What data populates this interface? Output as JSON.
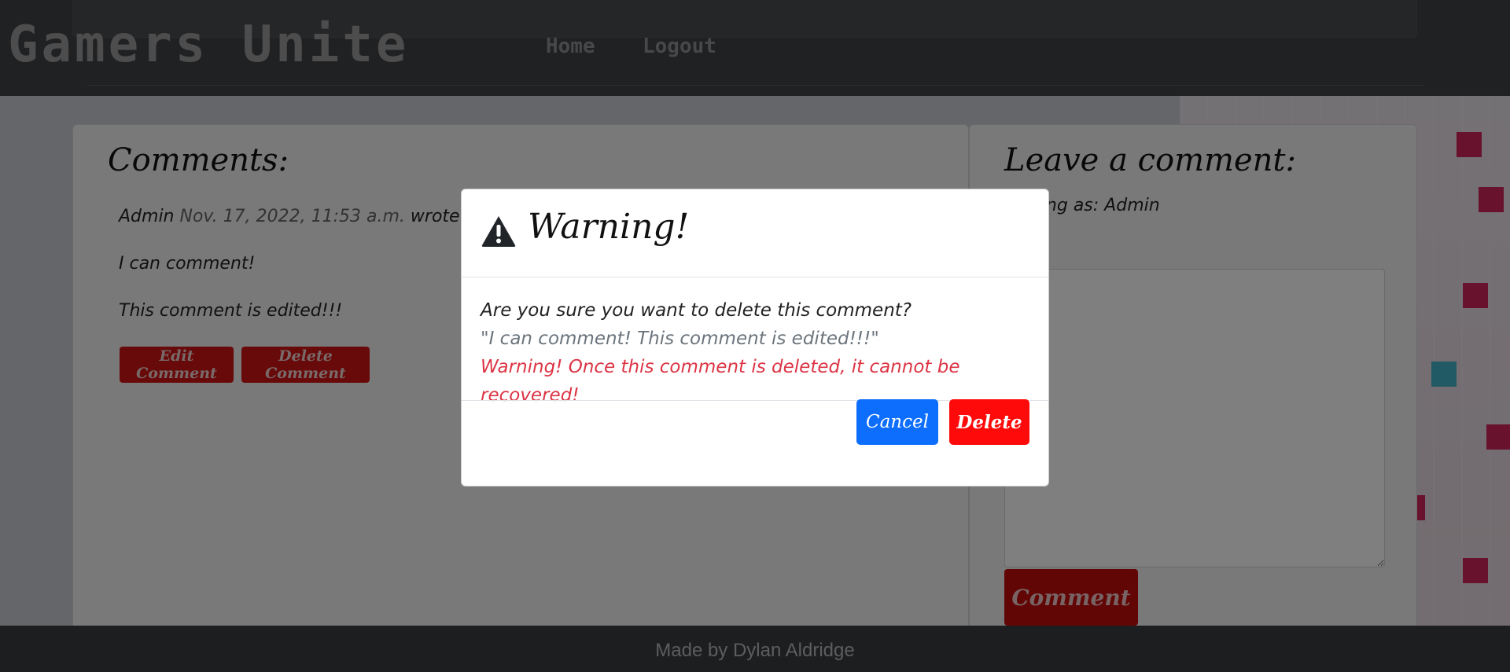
{
  "header": {
    "brand": "Gamers Unite",
    "nav": [
      "Home",
      "Logout"
    ]
  },
  "comments_panel": {
    "title": "Comments:",
    "comment": {
      "author": "Admin",
      "date": "Nov. 17, 2022, 11:53 a.m.",
      "wrote": "wrote:",
      "lines": [
        "I can comment!",
        "This comment is edited!!!"
      ],
      "edit_label": "Edit Comment",
      "delete_label": "Delete Comment"
    }
  },
  "leave_comment_panel": {
    "title": "Leave a comment:",
    "posting_as": "Posting as: Admin",
    "submit_label": "Comment"
  },
  "footer": {
    "text": "Made by Dylan Aldridge"
  },
  "modal": {
    "title": "Warning!",
    "question": "Are you sure you want to delete this comment?",
    "quote": "\"I can comment! This comment is edited!!!\"",
    "warning": "Warning! Once this comment is deleted, it cannot be recovered!",
    "cancel_label": "Cancel",
    "delete_label": "Delete"
  },
  "colors": {
    "primary_blue": "#0d6efd",
    "danger_red": "#ff0a0a",
    "brand_red": "#c40a0a",
    "warning_text": "#dc3545"
  },
  "icons": {
    "modal_icon": "warning-triangle-icon"
  }
}
